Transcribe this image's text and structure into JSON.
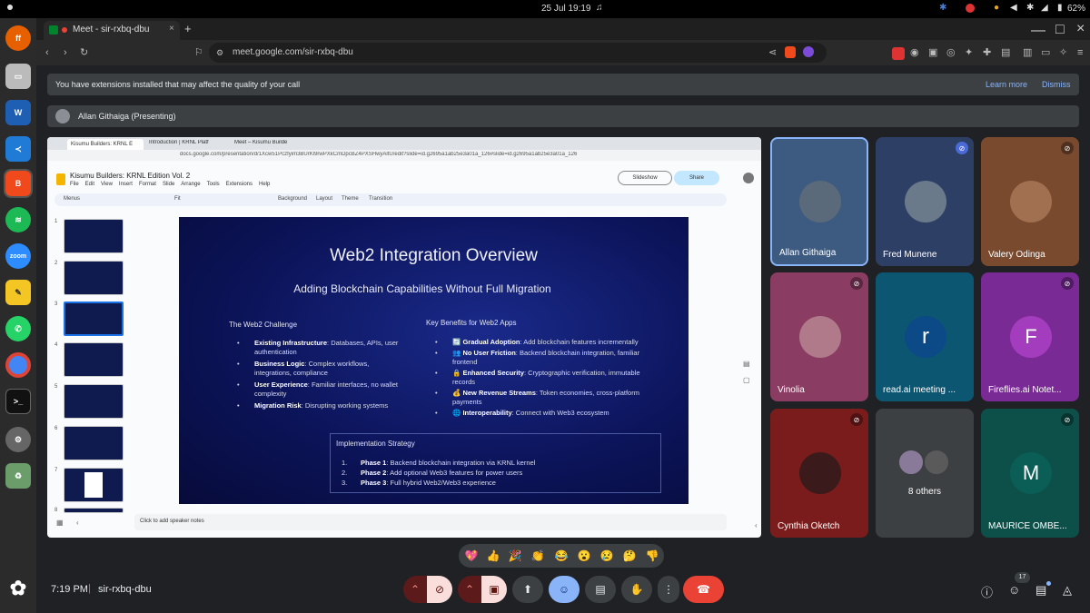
{
  "system": {
    "date_time": "25 Jul  19:19",
    "battery": "62%"
  },
  "browser": {
    "tab_title": "Meet - sir-rxbq-dbu",
    "url": "meet.google.com/sir-rxbq-dbu"
  },
  "banners": {
    "extensions_warning": "You have extensions installed that may affect the quality of your call",
    "learn_more": "Learn more",
    "dismiss": "Dismiss",
    "presenter": "Allan Githaiga (Presenting)"
  },
  "slides_app": {
    "tabs": [
      "Kisumu Builders: KRNL E",
      "Introduction | KRNL Platf",
      "Meet – Kisumu Builde"
    ],
    "url": "docs.google.com/presentation/d/1Xcw51Pczfyim3BUrKl9rwPXkCmDpcBZ4PXSHwyAltU/edit?slide=id.g2695a1ab25e3a01a_126#slide=id.g2695a1ab25e3a01a_126",
    "doc_title": "Kisumu Builders: KRNL Edition Vol. 2",
    "menus": [
      "File",
      "Edit",
      "View",
      "Insert",
      "Format",
      "Slide",
      "Arrange",
      "Tools",
      "Extensions",
      "Help"
    ],
    "toolbar": {
      "menus": "Menus",
      "fit": "Fit",
      "background": "Background",
      "layout": "Layout",
      "theme": "Theme",
      "transition": "Transition"
    },
    "slideshow": "Slideshow",
    "share": "Share",
    "thumb_numbers": [
      "1",
      "2",
      "3",
      "4",
      "5",
      "6",
      "7",
      "8"
    ],
    "speaker_notes": "Click to add speaker notes"
  },
  "slide": {
    "title": "Web2 Integration Overview",
    "subtitle": "Adding Blockchain Capabilities Without Full Migration",
    "left_heading": "The Web2 Challenge",
    "left_bullets": [
      {
        "bold": "Existing Infrastructure",
        "text": ": Databases, APIs, user authentication"
      },
      {
        "bold": "Business Logic",
        "text": ": Complex workflows, integrations, compliance"
      },
      {
        "bold": "User Experience",
        "text": ": Familiar interfaces, no wallet complexity"
      },
      {
        "bold": "Migration Risk",
        "text": ": Disrupting working systems"
      }
    ],
    "right_heading": "Key Benefits for Web2 Apps",
    "right_bullets": [
      {
        "emoji": "🔄",
        "bold": "Gradual Adoption",
        "text": ": Add blockchain features incrementally"
      },
      {
        "emoji": "👥",
        "bold": "No User Friction",
        "text": ": Backend blockchain integration, familiar frontend"
      },
      {
        "emoji": "🔒",
        "bold": "Enhanced Security",
        "text": ": Cryptographic verification, immutable records"
      },
      {
        "emoji": "💰",
        "bold": "New Revenue Streams",
        "text": ": Token economies, cross-platform payments"
      },
      {
        "emoji": "🌐",
        "bold": "Interoperability",
        "text": ": Connect with Web3 ecosystem"
      }
    ],
    "strategy_heading": "Implementation Strategy",
    "strategy_items": [
      {
        "num": "1.",
        "bold": "Phase 1",
        "text": ": Backend blockchain integration via KRNL kernel"
      },
      {
        "num": "2.",
        "bold": "Phase 2",
        "text": ": Add optional Web3 features for power users"
      },
      {
        "num": "3.",
        "bold": "Phase 3",
        "text": ": Full hybrid Web2/Web3 experience"
      }
    ]
  },
  "participants": [
    {
      "name": "Allan Githaiga",
      "muted": false,
      "bg": "#3d5a80"
    },
    {
      "name": "Fred Munene",
      "muted": true,
      "bg": "#2e3f66"
    },
    {
      "name": "Valery Odinga",
      "muted": true,
      "bg": "#7a4a2e"
    },
    {
      "name": "Vinolia",
      "muted": true,
      "bg": "#8a3c63"
    },
    {
      "name": "read.ai meeting ...",
      "initial": "r",
      "muted": false,
      "bg": "#0d5672",
      "avatar": "#0b4a86"
    },
    {
      "name": "Fireflies.ai Notet...",
      "initial": "F",
      "muted": true,
      "bg": "#7a2a95",
      "avatar": "#a43dbd"
    },
    {
      "name": "Cynthia Oketch",
      "muted": true,
      "bg": "#7a1c1c"
    },
    {
      "name": "8 others",
      "muted": false,
      "bg": "#3c4043"
    },
    {
      "name": "MAURICE OMBE...",
      "initial": "M",
      "muted": true,
      "bg": "#0d4f49",
      "avatar": "#0b5e56"
    }
  ],
  "reactions": [
    "💖",
    "👍",
    "🎉",
    "👏",
    "😂",
    "😮",
    "😢",
    "🤔",
    "👎"
  ],
  "footer": {
    "time": "7:19 PM",
    "meeting_code": "sir-rxbq-dbu",
    "people_count": "17"
  },
  "colors": {
    "end_call": "#ea4335",
    "muted_red": "#5c1a1a",
    "active_blue": "#8ab4f8"
  }
}
